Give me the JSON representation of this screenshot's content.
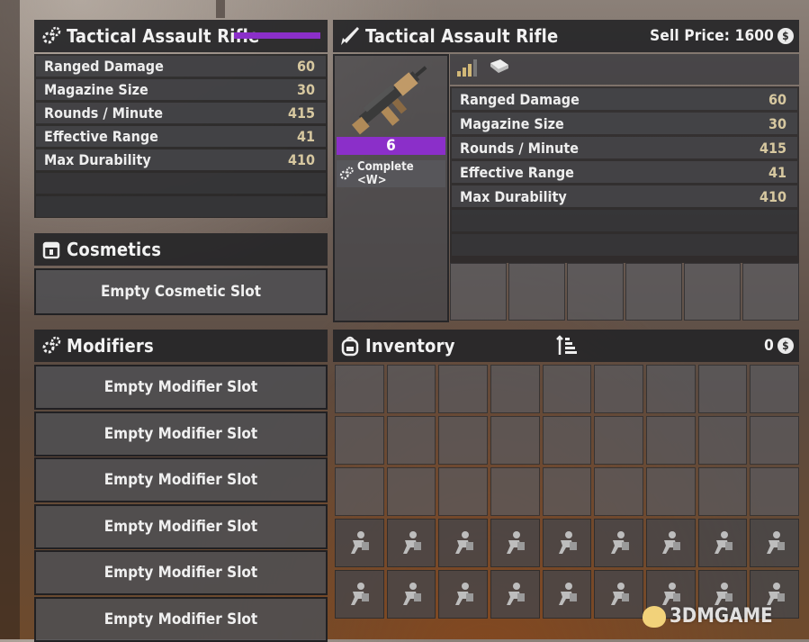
{
  "item": {
    "name": "Tactical Assault Rifle",
    "quality_color": "#8b2fc9",
    "quality_level": "6",
    "sell_label": "Sell Price: 1600",
    "assemble_label": "Complete <W>"
  },
  "stats": [
    {
      "label": "Ranged Damage",
      "value": "60"
    },
    {
      "label": "Magazine Size",
      "value": "30"
    },
    {
      "label": "Rounds / Minute",
      "value": "415"
    },
    {
      "label": "Effective Range",
      "value": "41"
    },
    {
      "label": "Max Durability",
      "value": "410"
    }
  ],
  "cosmetics": {
    "title": "Cosmetics",
    "slot_label": "Empty Cosmetic Slot"
  },
  "modifiers": {
    "title": "Modifiers",
    "slot_labels": [
      "Empty Modifier Slot",
      "Empty Modifier Slot",
      "Empty Modifier Slot",
      "Empty Modifier Slot",
      "Empty Modifier Slot",
      "Empty Modifier Slot"
    ]
  },
  "inventory": {
    "title": "Inventory",
    "currency": "0",
    "unlocked_rows": 3,
    "locked_rows": 2,
    "columns": 9
  },
  "icons": {
    "gear": "gear-icon",
    "rifle": "rifle-icon",
    "paint_bucket": "paint-bucket-icon",
    "backpack": "backpack-icon",
    "sort": "sort-icon",
    "coin": "coin-icon",
    "signal": "signal-bars-icon",
    "book": "book-icon",
    "locked_slot": "locked-slot-icon"
  },
  "watermark": "3DMGAME",
  "coin_symbol": "$"
}
